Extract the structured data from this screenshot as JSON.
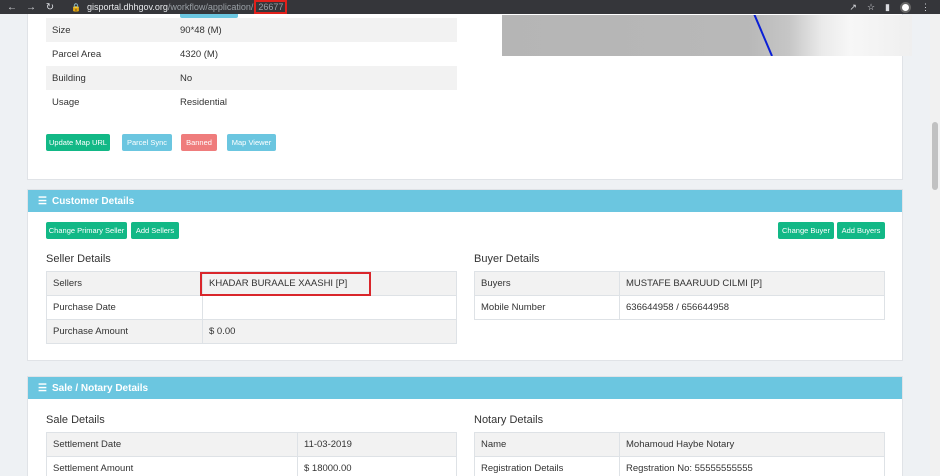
{
  "browser": {
    "host": "gisportal.dhhgov.org",
    "path": "/workflow/application/",
    "app_id": "26677"
  },
  "parcel": {
    "rows": [
      {
        "label": "Size",
        "value": "90*48 (M)"
      },
      {
        "label": "Parcel Area",
        "value": "4320 (M)"
      },
      {
        "label": "Building",
        "value": "No"
      },
      {
        "label": "Usage",
        "value": "Residential"
      }
    ],
    "buttons": {
      "update_map_url": "Update Map URL",
      "parcel_sync": "Parcel Sync",
      "banned": "Banned",
      "map_viewer": "Map Viewer"
    }
  },
  "customer": {
    "title": "Customer Details",
    "buttons": {
      "change_primary_seller": "Change Primary Seller",
      "add_sellers": "Add Sellers",
      "change_buyer": "Change Buyer",
      "add_buyers": "Add Buyers"
    },
    "seller_title": "Seller Details",
    "seller_rows": [
      {
        "label": "Sellers",
        "value": "KHADAR BURAALE XAASHI [P]"
      },
      {
        "label": "Purchase Date",
        "value": ""
      },
      {
        "label": "Purchase Amount",
        "value": "$ 0.00"
      }
    ],
    "buyer_title": "Buyer Details",
    "buyer_rows": [
      {
        "label": "Buyers",
        "value": "MUSTAFE BAARUUD CILMI [P]"
      },
      {
        "label": "Mobile Number",
        "value": "636644958 / 656644958"
      }
    ]
  },
  "sale": {
    "title": "Sale / Notary Details",
    "sale_title": "Sale Details",
    "sale_rows": [
      {
        "label": "Settlement Date",
        "value": "11-03-2019"
      },
      {
        "label": "Settlement Amount",
        "value": "$ 18000.00"
      }
    ],
    "notary_title": "Notary Details",
    "notary_rows": [
      {
        "label": "Name",
        "value": "Mohamoud Haybe Notary"
      },
      {
        "label": "Registration Details",
        "value": "Regstration No: 55555555555"
      }
    ]
  },
  "colors": {
    "header": "#6bc6e0",
    "success": "#12b886",
    "danger": "#ef7c7c",
    "highlight": "#d9262b"
  }
}
